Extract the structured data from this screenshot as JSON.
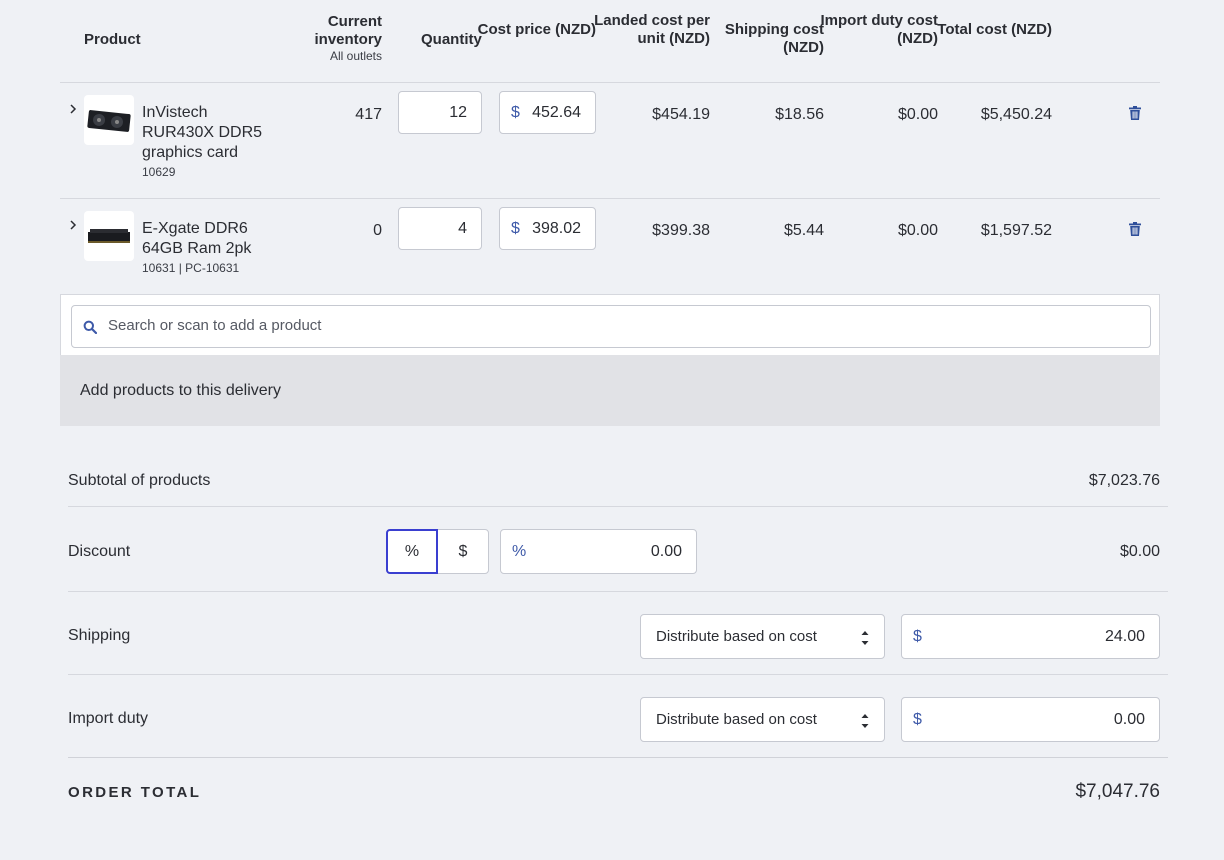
{
  "table": {
    "headers": {
      "product": "Product",
      "inventory": "Current inventory",
      "inventory_sub": "All outlets",
      "quantity": "Quantity",
      "cost_price": "Cost price (NZD)",
      "landed_cost": "Landed cost per unit (NZD)",
      "shipping_cost": "Shipping cost (NZD)",
      "import_duty": "Import duty cost (NZD)",
      "total_cost": "Total cost (NZD)"
    },
    "rows": [
      {
        "name": "InVistech RUR430X DDR5 graphics card",
        "sku": "10629",
        "inventory": "417",
        "quantity": "12",
        "currency": "$",
        "cost_price": "452.64",
        "landed_cost": "$454.19",
        "shipping_cost": "$18.56",
        "import_duty": "$0.00",
        "total_cost": "$5,450.24",
        "thumb_icon": "graphics-card-image"
      },
      {
        "name": "E-Xgate DDR6 64GB Ram 2pk",
        "sku": "10631 | PC-10631",
        "inventory": "0",
        "quantity": "4",
        "currency": "$",
        "cost_price": "398.02",
        "landed_cost": "$399.38",
        "shipping_cost": "$5.44",
        "import_duty": "$0.00",
        "total_cost": "$1,597.52",
        "thumb_icon": "ram-module-image"
      }
    ]
  },
  "search": {
    "placeholder": "Search or scan to add a product",
    "icon": "search-icon"
  },
  "add_panel": {
    "label": "Add products to this delivery"
  },
  "summary": {
    "subtotal_label": "Subtotal of products",
    "subtotal_value": "$7,023.76",
    "discount_label": "Discount",
    "discount_toggle_pct": "%",
    "discount_toggle_usd": "$",
    "discount_input_prefix": "%",
    "discount_input_value": "0.00",
    "discount_value": "$0.00",
    "shipping_label": "Shipping",
    "shipping_method": "Distribute based on cost",
    "shipping_currency": "$",
    "shipping_amount": "24.00",
    "duty_label": "Import duty",
    "duty_method": "Distribute based on cost",
    "duty_currency": "$",
    "duty_amount": "0.00",
    "total_label": "ORDER TOTAL",
    "total_value": "$7,047.76"
  },
  "colors": {
    "background": "#eff1f5",
    "accent": "#3a3fd0",
    "currency_symbol": "#3d59a8",
    "trash_icon": "#2f4f9a"
  }
}
